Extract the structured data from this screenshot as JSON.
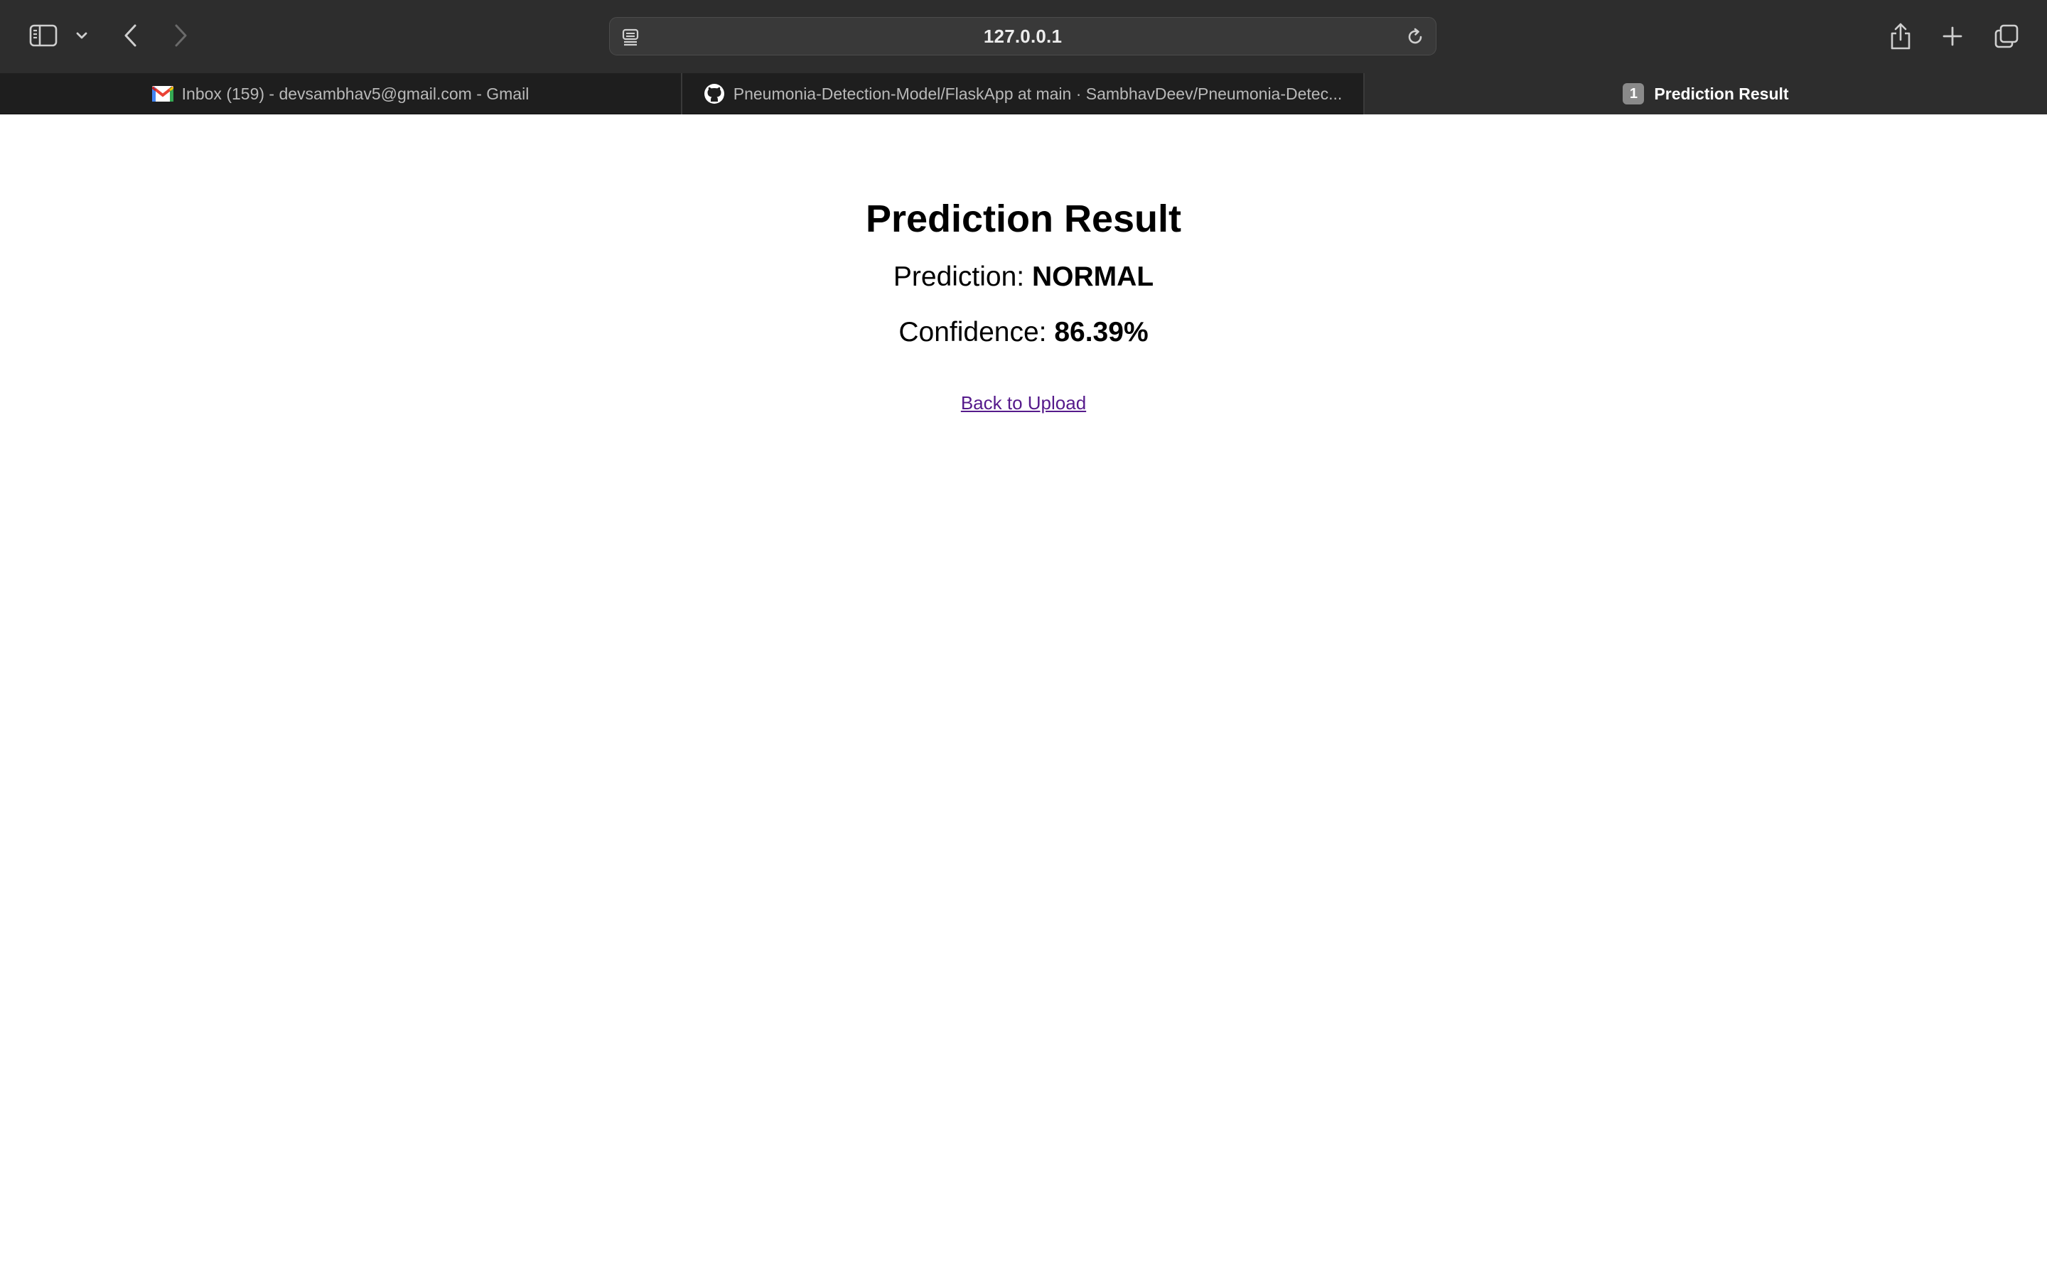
{
  "browser": {
    "url": "127.0.0.1",
    "icons": {
      "sidebar": "sidebar-icon",
      "chevron": "chevron-down-icon",
      "back": "back-arrow-icon",
      "forward": "forward-arrow-icon",
      "reader": "reader-icon",
      "reload": "reload-icon",
      "share": "share-icon",
      "new_tab": "plus-icon",
      "tabs_overview": "tabs-overview-icon"
    }
  },
  "tabs": [
    {
      "label": "Inbox (159) - devsambhav5@gmail.com - Gmail",
      "icon": "gmail-icon",
      "active": false
    },
    {
      "label": "Pneumonia-Detection-Model/FlaskApp at main · SambhavDeev/Pneumonia-Detec...",
      "icon": "github-icon",
      "active": false
    },
    {
      "label": "Prediction Result",
      "badge": "1",
      "active": true
    }
  ],
  "page": {
    "title": "Prediction Result",
    "prediction_label": "Prediction: ",
    "prediction_value": "NORMAL",
    "confidence_label": "Confidence: ",
    "confidence_value": "86.39%",
    "back_link": "Back to Upload"
  },
  "colors": {
    "toolbar": "#2d2d2d",
    "tabbar": "#1e1e1e",
    "link_visited": "#551a8b"
  }
}
